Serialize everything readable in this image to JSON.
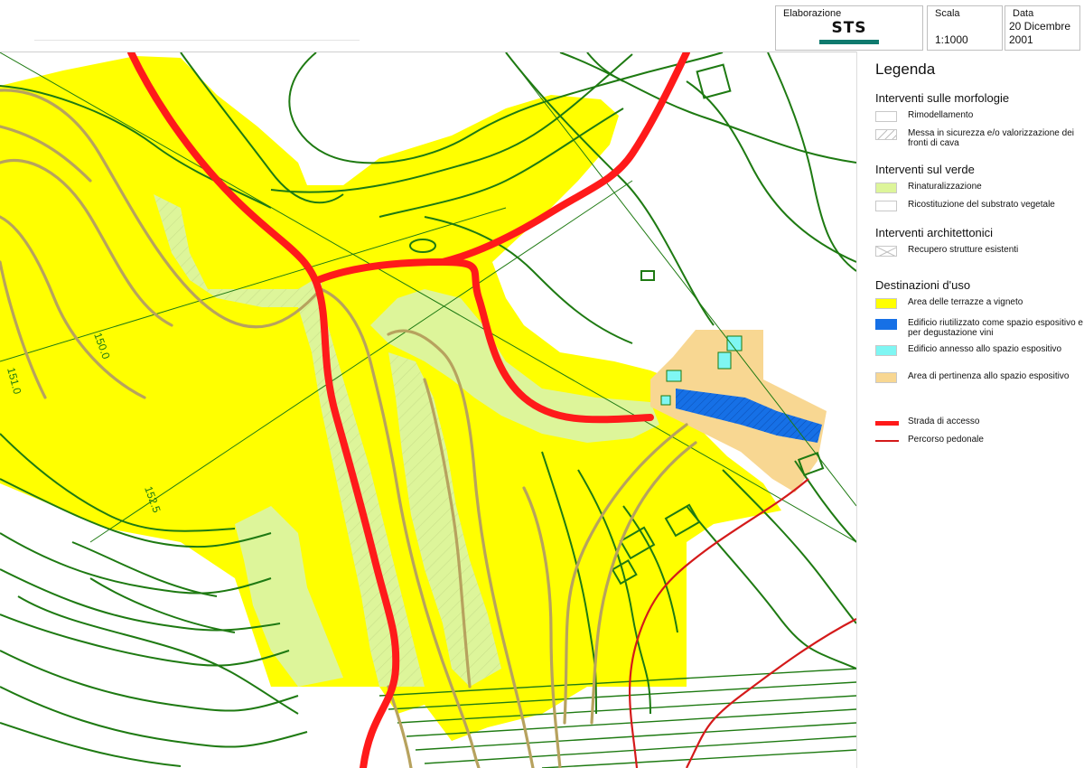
{
  "header": {
    "elaborazione_label": "Elaborazione",
    "logo_text": "STS",
    "scala_label": "Scala",
    "scala_value": "1:1000",
    "data_label": "Data",
    "data_value_line1": "20 Dicembre",
    "data_value_line2": "2001"
  },
  "legend": {
    "title": "Legenda",
    "sections": [
      {
        "title": "Interventi sulle morfologie",
        "items": [
          {
            "label": "Rimodellamento",
            "swatch": "#ffffff",
            "pattern": "none"
          },
          {
            "label": "Messa in sicurezza e/o valorizzazione dei fronti di cava",
            "swatch": "#ffffff",
            "pattern": "hatch"
          }
        ]
      },
      {
        "title": "Interventi sul verde",
        "items": [
          {
            "label": "Rinaturalizzazione",
            "swatch": "#ddf59a",
            "pattern": "none"
          },
          {
            "label": "Ricostituzione del substrato vegetale",
            "swatch": "#ffffff",
            "pattern": "none"
          }
        ]
      },
      {
        "title": "Interventi architettonici",
        "items": [
          {
            "label": "Recupero strutture esistenti",
            "swatch": "#ffffff",
            "pattern": "cross"
          }
        ]
      },
      {
        "title": "Destinazioni d'uso",
        "items": [
          {
            "label": "Area delle terrazze a vigneto",
            "swatch": "#ffff00",
            "pattern": "none"
          },
          {
            "label": "Edificio riutilizzato come spazio espositivo e per degustazione vini",
            "swatch": "#1670e6",
            "pattern": "none"
          },
          {
            "label": "Edificio annesso allo spazio espositivo",
            "swatch": "#7ff6f3",
            "pattern": "none"
          },
          {
            "label": "Area di pertinenza allo spazio espositivo",
            "swatch": "#f8d792",
            "pattern": "none"
          }
        ]
      }
    ],
    "lines": [
      {
        "label": "Strada di accesso",
        "color": "#ff1a1a",
        "style": "thick"
      },
      {
        "label": "Percorso pedonale",
        "color": "#d41a1a",
        "style": "thin"
      }
    ]
  },
  "map": {
    "contour_labels": [
      "151.0",
      "150.0",
      "152.5"
    ],
    "colors": {
      "vineyard": "#ffff00",
      "renaturalization": "#ddf59a",
      "exhibition_building": "#1670e6",
      "annex_building": "#7ff6f3",
      "pertinence_area": "#f8d792",
      "contours": "#1e7a12",
      "terraces": "#b7a25e",
      "access_road": "#ff1a1a",
      "footpath": "#d41a1a"
    }
  }
}
